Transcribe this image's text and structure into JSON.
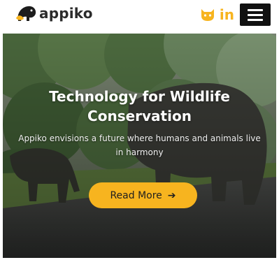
{
  "brand": {
    "name": "appiko"
  },
  "nav": {
    "icons": [
      "github-icon",
      "linkedin-icon",
      "hamburger-menu-icon"
    ],
    "linkedin_text": "in"
  },
  "hero": {
    "title_line1": "Technology for Wildlife",
    "title_line2": "Conservation",
    "subtitle": "Appiko envisions a future where humans and animals live in harmony",
    "cta_label": "Read More",
    "cta_arrow": "➔"
  },
  "colors": {
    "accent": "#f7b41f",
    "menu_bg": "#111111",
    "text_dark": "#2b2b2b"
  }
}
